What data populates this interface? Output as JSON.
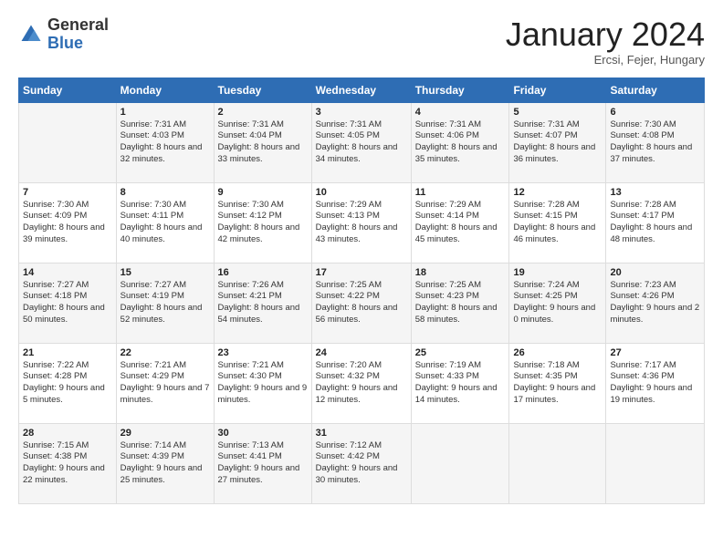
{
  "logo": {
    "general": "General",
    "blue": "Blue"
  },
  "header": {
    "month": "January 2024",
    "location": "Ercsi, Fejer, Hungary"
  },
  "weekdays": [
    "Sunday",
    "Monday",
    "Tuesday",
    "Wednesday",
    "Thursday",
    "Friday",
    "Saturday"
  ],
  "weeks": [
    [
      {
        "day": "",
        "info": ""
      },
      {
        "day": "1",
        "info": "Sunrise: 7:31 AM\nSunset: 4:03 PM\nDaylight: 8 hours\nand 32 minutes."
      },
      {
        "day": "2",
        "info": "Sunrise: 7:31 AM\nSunset: 4:04 PM\nDaylight: 8 hours\nand 33 minutes."
      },
      {
        "day": "3",
        "info": "Sunrise: 7:31 AM\nSunset: 4:05 PM\nDaylight: 8 hours\nand 34 minutes."
      },
      {
        "day": "4",
        "info": "Sunrise: 7:31 AM\nSunset: 4:06 PM\nDaylight: 8 hours\nand 35 minutes."
      },
      {
        "day": "5",
        "info": "Sunrise: 7:31 AM\nSunset: 4:07 PM\nDaylight: 8 hours\nand 36 minutes."
      },
      {
        "day": "6",
        "info": "Sunrise: 7:30 AM\nSunset: 4:08 PM\nDaylight: 8 hours\nand 37 minutes."
      }
    ],
    [
      {
        "day": "7",
        "info": "Sunrise: 7:30 AM\nSunset: 4:09 PM\nDaylight: 8 hours\nand 39 minutes."
      },
      {
        "day": "8",
        "info": "Sunrise: 7:30 AM\nSunset: 4:11 PM\nDaylight: 8 hours\nand 40 minutes."
      },
      {
        "day": "9",
        "info": "Sunrise: 7:30 AM\nSunset: 4:12 PM\nDaylight: 8 hours\nand 42 minutes."
      },
      {
        "day": "10",
        "info": "Sunrise: 7:29 AM\nSunset: 4:13 PM\nDaylight: 8 hours\nand 43 minutes."
      },
      {
        "day": "11",
        "info": "Sunrise: 7:29 AM\nSunset: 4:14 PM\nDaylight: 8 hours\nand 45 minutes."
      },
      {
        "day": "12",
        "info": "Sunrise: 7:28 AM\nSunset: 4:15 PM\nDaylight: 8 hours\nand 46 minutes."
      },
      {
        "day": "13",
        "info": "Sunrise: 7:28 AM\nSunset: 4:17 PM\nDaylight: 8 hours\nand 48 minutes."
      }
    ],
    [
      {
        "day": "14",
        "info": "Sunrise: 7:27 AM\nSunset: 4:18 PM\nDaylight: 8 hours\nand 50 minutes."
      },
      {
        "day": "15",
        "info": "Sunrise: 7:27 AM\nSunset: 4:19 PM\nDaylight: 8 hours\nand 52 minutes."
      },
      {
        "day": "16",
        "info": "Sunrise: 7:26 AM\nSunset: 4:21 PM\nDaylight: 8 hours\nand 54 minutes."
      },
      {
        "day": "17",
        "info": "Sunrise: 7:25 AM\nSunset: 4:22 PM\nDaylight: 8 hours\nand 56 minutes."
      },
      {
        "day": "18",
        "info": "Sunrise: 7:25 AM\nSunset: 4:23 PM\nDaylight: 8 hours\nand 58 minutes."
      },
      {
        "day": "19",
        "info": "Sunrise: 7:24 AM\nSunset: 4:25 PM\nDaylight: 9 hours\nand 0 minutes."
      },
      {
        "day": "20",
        "info": "Sunrise: 7:23 AM\nSunset: 4:26 PM\nDaylight: 9 hours\nand 2 minutes."
      }
    ],
    [
      {
        "day": "21",
        "info": "Sunrise: 7:22 AM\nSunset: 4:28 PM\nDaylight: 9 hours\nand 5 minutes."
      },
      {
        "day": "22",
        "info": "Sunrise: 7:21 AM\nSunset: 4:29 PM\nDaylight: 9 hours\nand 7 minutes."
      },
      {
        "day": "23",
        "info": "Sunrise: 7:21 AM\nSunset: 4:30 PM\nDaylight: 9 hours\nand 9 minutes."
      },
      {
        "day": "24",
        "info": "Sunrise: 7:20 AM\nSunset: 4:32 PM\nDaylight: 9 hours\nand 12 minutes."
      },
      {
        "day": "25",
        "info": "Sunrise: 7:19 AM\nSunset: 4:33 PM\nDaylight: 9 hours\nand 14 minutes."
      },
      {
        "day": "26",
        "info": "Sunrise: 7:18 AM\nSunset: 4:35 PM\nDaylight: 9 hours\nand 17 minutes."
      },
      {
        "day": "27",
        "info": "Sunrise: 7:17 AM\nSunset: 4:36 PM\nDaylight: 9 hours\nand 19 minutes."
      }
    ],
    [
      {
        "day": "28",
        "info": "Sunrise: 7:15 AM\nSunset: 4:38 PM\nDaylight: 9 hours\nand 22 minutes."
      },
      {
        "day": "29",
        "info": "Sunrise: 7:14 AM\nSunset: 4:39 PM\nDaylight: 9 hours\nand 25 minutes."
      },
      {
        "day": "30",
        "info": "Sunrise: 7:13 AM\nSunset: 4:41 PM\nDaylight: 9 hours\nand 27 minutes."
      },
      {
        "day": "31",
        "info": "Sunrise: 7:12 AM\nSunset: 4:42 PM\nDaylight: 9 hours\nand 30 minutes."
      },
      {
        "day": "",
        "info": ""
      },
      {
        "day": "",
        "info": ""
      },
      {
        "day": "",
        "info": ""
      }
    ]
  ]
}
